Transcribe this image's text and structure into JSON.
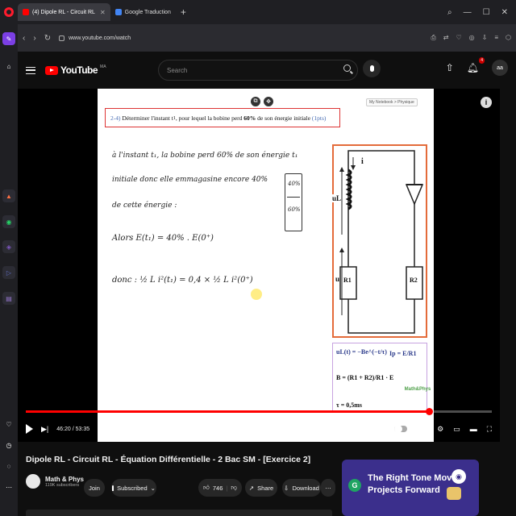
{
  "browser": {
    "tabs": [
      {
        "label": "(4) Dipole RL - Circuit RL",
        "active": true
      },
      {
        "label": "Google Traduction",
        "active": false
      }
    ],
    "url": "www.youtube.com/watch"
  },
  "header": {
    "logo_text": "YouTube",
    "country_code": "MA",
    "search_placeholder": "Search",
    "notification_count": "4",
    "avatar_initials": "aa"
  },
  "slide": {
    "question": {
      "number": "2-4)",
      "text_before": "Déterminer l'instant t",
      "subscript": "1",
      "text_middle": ", pour lequel la bobine perd",
      "bold": "60%",
      "text_after": "de son énergie initiale",
      "points": "(1pts)"
    },
    "notebook_label": "My Notebook > Physique",
    "handwriting": [
      "à l'instant t₁, la bobine perd 60% de son énergie t₁",
      "initiale donc elle emmagasine encore 40%",
      "de cette énergie :",
      "Alors   E(t₁) = 40% . E(0⁺)",
      "donc :   ½ L i²(t₁) = 0,4 × ½ L i²(0⁺)"
    ],
    "fraction_top": "40%",
    "fraction_bottom": "60%",
    "circuit_labels": {
      "current": "i",
      "inductor_voltage": "uL",
      "voltage": "u",
      "r1": "R1",
      "r2": "R2"
    },
    "formulas": {
      "f1": "uL(t) = −Be^(−t/τ)",
      "f2": "B = (R1 + R2)/R1 · E",
      "f3": "τ = 0,5ms",
      "f4": "Ip = E/R1"
    },
    "watermark": "Math&Phys"
  },
  "player": {
    "time_label": "46:20 / 53:35",
    "progress": 0.865
  },
  "video": {
    "title": "Dipole RL - Circuit RL - Équation Différentielle - 2 Bac SM - [Exercice 2]",
    "channel": "Math & Phys",
    "subscribers": "119K subscribers",
    "join_label": "Join",
    "subscribed_label": "Subscribed",
    "likes": "746",
    "share_label": "Share",
    "download_label": "Download"
  },
  "ad": {
    "line1": "The Right Tone Moves",
    "line2": "Projects Forward"
  }
}
